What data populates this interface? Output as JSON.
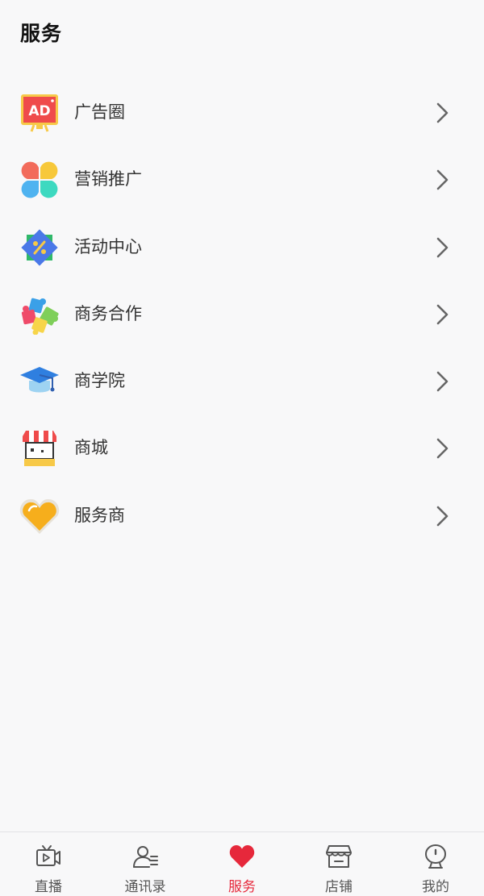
{
  "header": {
    "title": "服务"
  },
  "menu": {
    "items": [
      {
        "label": "广告圈",
        "icon": "ad-board-icon"
      },
      {
        "label": "营销推广",
        "icon": "clover-icon"
      },
      {
        "label": "活动中心",
        "icon": "discount-badge-icon"
      },
      {
        "label": "商务合作",
        "icon": "puzzle-icon"
      },
      {
        "label": "商学院",
        "icon": "graduation-cap-icon"
      },
      {
        "label": "商城",
        "icon": "storefront-icon"
      },
      {
        "label": "服务商",
        "icon": "heart-badge-icon"
      }
    ]
  },
  "tabbar": {
    "active_color": "#e6283b",
    "tabs": [
      {
        "label": "直播",
        "icon": "video-icon",
        "active": false
      },
      {
        "label": "通讯录",
        "icon": "contacts-icon",
        "active": false
      },
      {
        "label": "服务",
        "icon": "heart-icon",
        "active": true
      },
      {
        "label": "店铺",
        "icon": "store-icon",
        "active": false
      },
      {
        "label": "我的",
        "icon": "profile-icon",
        "active": false
      }
    ]
  }
}
